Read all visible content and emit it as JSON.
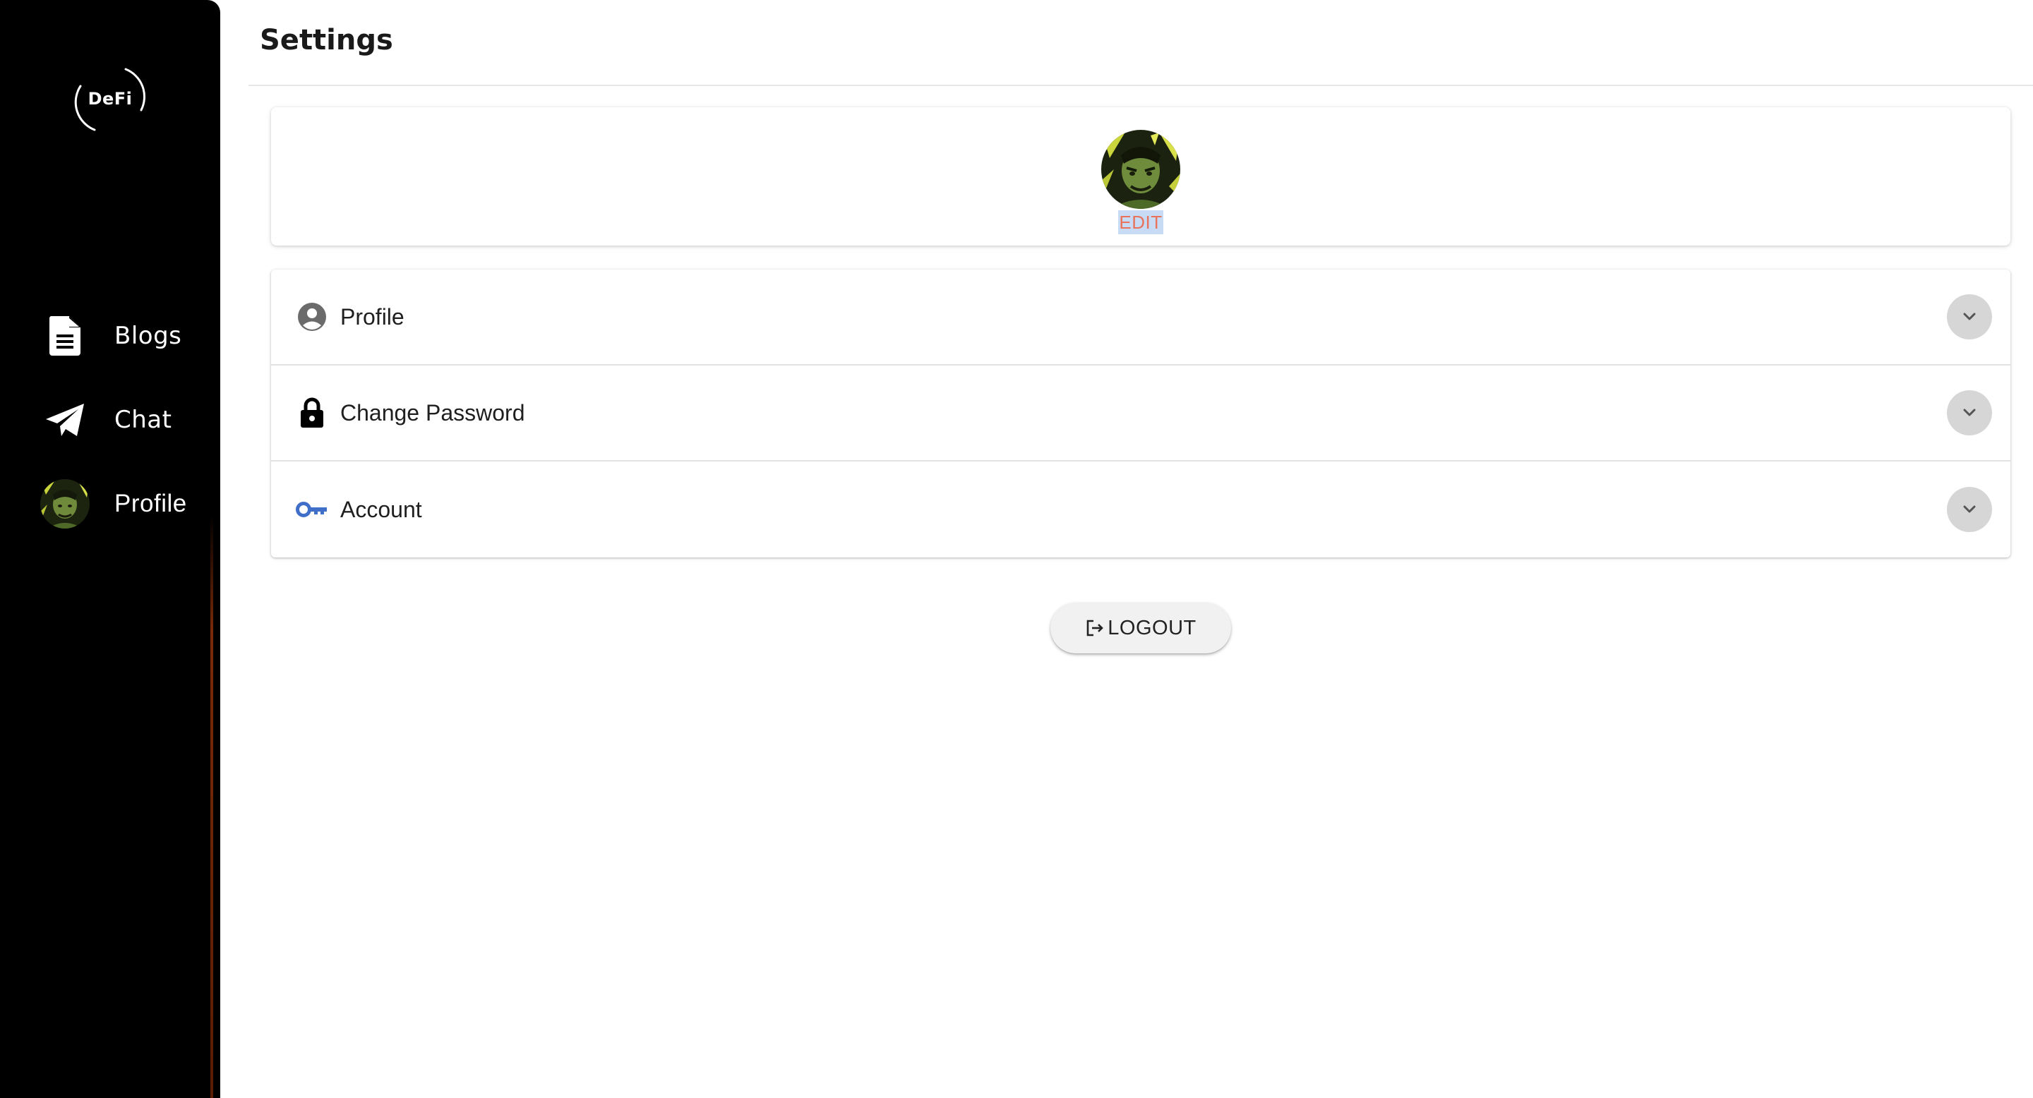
{
  "page": {
    "title": "Settings"
  },
  "sidebar": {
    "logo_text": "DeFi",
    "items": [
      {
        "label": "Blogs",
        "icon": "document-icon"
      },
      {
        "label": "Chat",
        "icon": "paper-plane-icon"
      },
      {
        "label": "Profile",
        "icon": "avatar",
        "active": true
      }
    ]
  },
  "avatar_card": {
    "edit_label": "EDIT"
  },
  "accordion": {
    "sections": [
      {
        "label": "Profile",
        "icon": "user-circle-icon"
      },
      {
        "label": "Change Password",
        "icon": "lock-icon"
      },
      {
        "label": "Account",
        "icon": "key-icon",
        "icon_color": "#3f6fc9"
      }
    ]
  },
  "logout": {
    "label": "LOGOUT",
    "icon": "logout-icon"
  },
  "colors": {
    "sidebar_bg": "#000000",
    "edit_text": "#e8735a",
    "edit_highlight": "#c7dbf4",
    "key_icon": "#3f6fc9"
  }
}
